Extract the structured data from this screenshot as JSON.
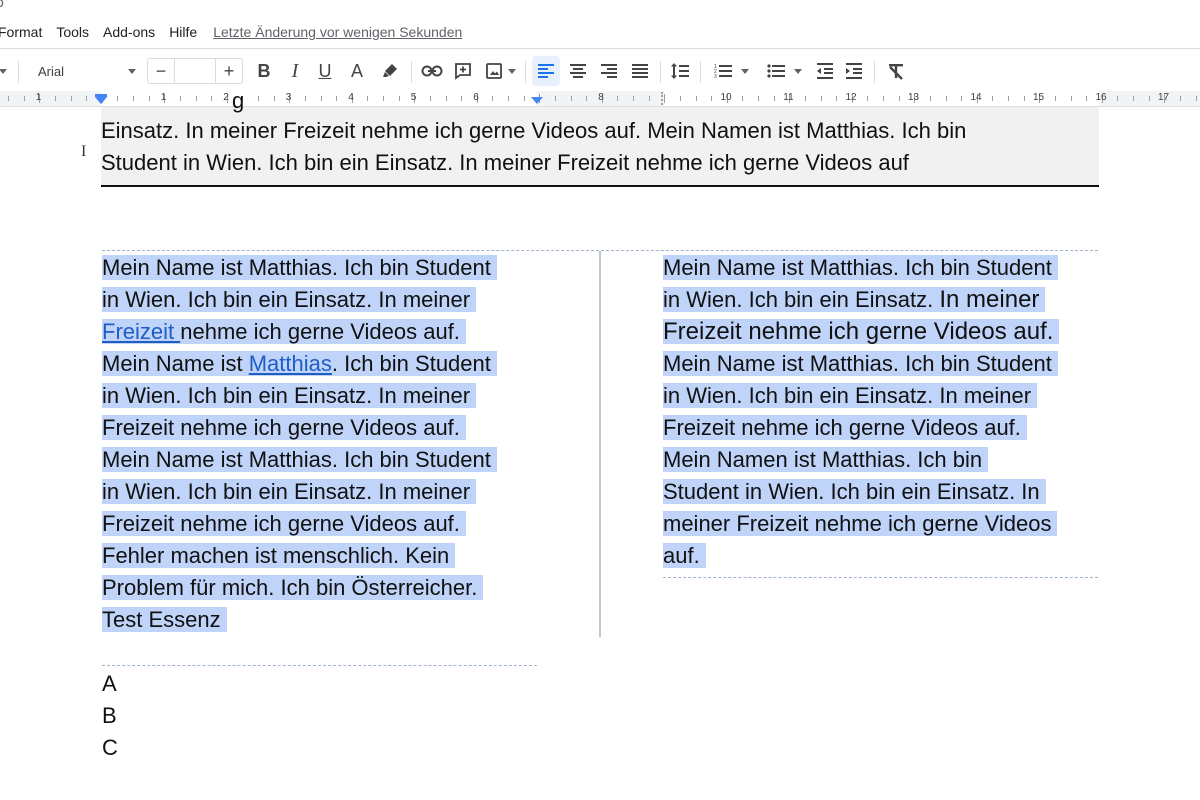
{
  "menu": {
    "items": [
      "Format",
      "Tools",
      "Add-ons",
      "Hilfe"
    ],
    "last_edit": "Letzte Änderung vor wenigen Sekunden"
  },
  "toolbar": {
    "font_name": "Arial",
    "font_size": "",
    "decrease_size": "−",
    "increase_size": "+",
    "bold": "B",
    "italic": "I",
    "underline": "U",
    "text_color": "A",
    "alignment_selected": "left",
    "accent_color": "#1a73e8"
  },
  "ruler": {
    "left_numbers": [
      "1"
    ],
    "numbers": [
      "1",
      "2",
      "3",
      "4",
      "5",
      "6",
      "8",
      "10",
      "11",
      "12",
      "13",
      "14",
      "15",
      "16",
      "17"
    ]
  },
  "document": {
    "heading_box": {
      "lines": [
        "Einsatz. In meiner Freizeit nehme ich gerne Videos auf. Mein Namen ist Matthias. Ich bin",
        "Student in Wien. Ich bin ein Einsatz. In meiner Freizeit nehme ich gerne Videos auf"
      ]
    },
    "left_column": {
      "lines": [
        {
          "text": "Mein Name ist Matthias. Ich bin Student"
        },
        {
          "text": "in Wien. Ich bin ein Einsatz. In meiner"
        },
        {
          "link": "Freizeit ",
          "text": "nehme ich gerne Videos auf."
        },
        {
          "pre": "Mein Name ist ",
          "link": "Matthias",
          "text": ". Ich bin Student"
        },
        {
          "text": "in Wien. Ich bin ein Einsatz. In meiner"
        },
        {
          "text": "Freizeit nehme ich gerne Videos auf."
        },
        {
          "text": "Mein Name ist Matthias. Ich bin Student"
        },
        {
          "text": "in Wien. Ich bin ein Einsatz. In meiner"
        },
        {
          "text": "Freizeit nehme ich gerne Videos auf."
        },
        {
          "text": "Fehler machen ist menschlich. Kein"
        },
        {
          "text": "Problem für mich. Ich bin Österreicher."
        },
        {
          "text": "Test Essenz"
        }
      ]
    },
    "right_column": {
      "lines": [
        {
          "text": "Mein Name ist Matthias. Ich bin Student"
        },
        {
          "pre": "in Wien. Ich bin ein Einsatz. ",
          "big": "In meiner"
        },
        {
          "big": "Freizeit nehme ich gerne Videos auf."
        },
        {
          "text": "Mein Name ist Matthias. Ich bin Student"
        },
        {
          "text": "in Wien. Ich bin ein Einsatz. In meiner"
        },
        {
          "text": "Freizeit nehme ich gerne Videos auf."
        },
        {
          "text": "Mein Namen ist Matthias. Ich bin"
        },
        {
          "text": "Student in Wien. Ich bin ein Einsatz. In"
        },
        {
          "text": "meiner Freizeit nehme ich gerne Videos"
        },
        {
          "text": "auf."
        }
      ]
    },
    "after_columns": [
      "A",
      "B",
      "C"
    ],
    "selection_color": "#c0d4fa",
    "link_color": "#1e5ec4"
  }
}
